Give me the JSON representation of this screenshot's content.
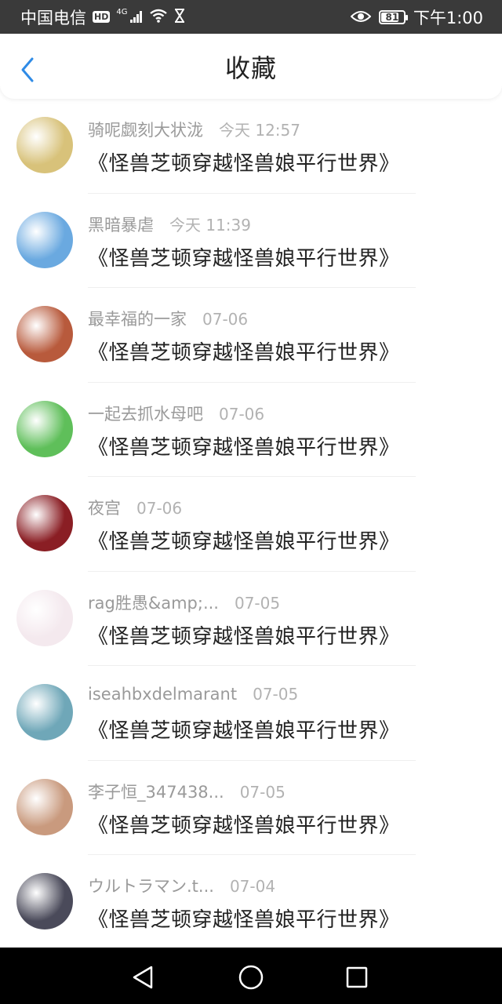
{
  "status_bar": {
    "carrier": "中国电信",
    "hd_badge": "HD",
    "network": "4G",
    "battery_level": "81",
    "battery_fraction": 0.81,
    "time": "下午1:00",
    "icons": [
      "signal-icon",
      "wifi-icon",
      "hourglass-icon",
      "eye-icon",
      "battery-icon"
    ]
  },
  "header": {
    "title": "收藏",
    "back_icon": "chevron-left-icon",
    "accent_color": "#2f8be6"
  },
  "favorites": [
    {
      "author": "骑呢觑刻大状泷",
      "time": "今天 12:57",
      "title": "《怪兽芝顿穿越怪兽娘平行世界》",
      "avatar_color": "#d8c27a"
    },
    {
      "author": "黑暗暴虐",
      "time": "今天 11:39",
      "title": "《怪兽芝顿穿越怪兽娘平行世界》",
      "avatar_color": "#6aa9e0"
    },
    {
      "author": "最幸福的一家",
      "time": "07-06",
      "title": "《怪兽芝顿穿越怪兽娘平行世界》",
      "avatar_color": "#b85a3c"
    },
    {
      "author": "一起去抓水母吧",
      "time": "07-06",
      "title": "《怪兽芝顿穿越怪兽娘平行世界》",
      "avatar_color": "#5fbf5a"
    },
    {
      "author": "夜宫",
      "time": "07-06",
      "title": "《怪兽芝顿穿越怪兽娘平行世界》",
      "avatar_color": "#8a1e24"
    },
    {
      "author": "rag胜愚&amp;...",
      "time": "07-05",
      "title": "《怪兽芝顿穿越怪兽娘平行世界》",
      "avatar_color": "#f4e9ee"
    },
    {
      "author": "iseahbxdelmarant",
      "time": "07-05",
      "title": "《怪兽芝顿穿越怪兽娘平行世界》",
      "avatar_color": "#6fa7b8"
    },
    {
      "author": "李子恒_347438...",
      "time": "07-05",
      "title": "《怪兽芝顿穿越怪兽娘平行世界》",
      "avatar_color": "#c99a7e"
    },
    {
      "author": "ウルトラマン.t...",
      "time": "07-04",
      "title": "《怪兽芝顿穿越怪兽娘平行世界》",
      "avatar_color": "#4a4a5a"
    }
  ],
  "nav_bar": {
    "icons": [
      "back-triangle-icon",
      "home-circle-icon",
      "recents-square-icon"
    ]
  }
}
